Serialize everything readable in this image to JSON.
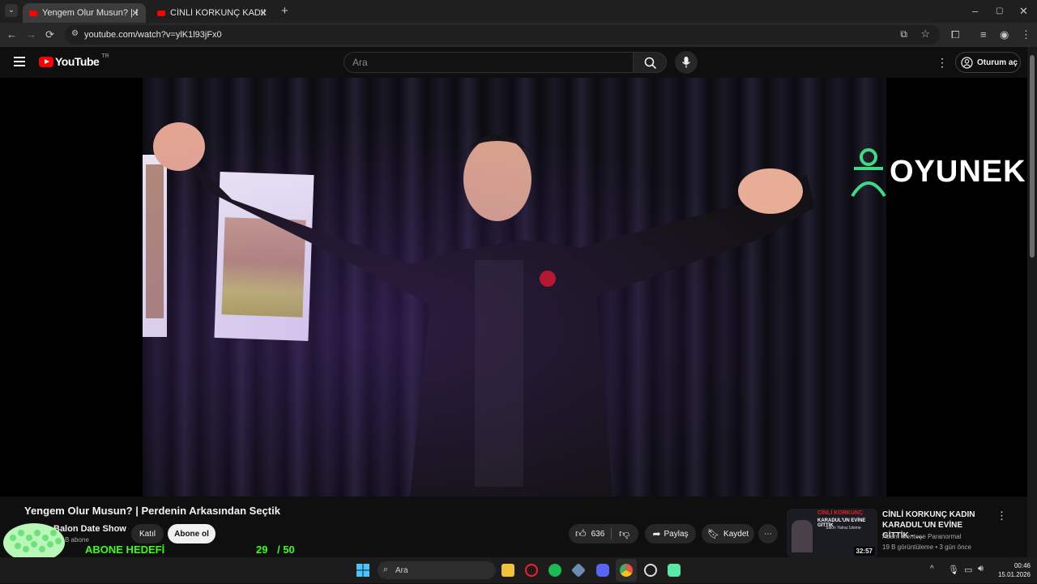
{
  "browser": {
    "tabs": [
      {
        "title": "Yengem Olur Musun? | Perdenin Arkasından Seçtik"
      },
      {
        "title": "CİNLİ KORKUNÇ KADIN KARADUL'UN EVİNE GİTTİK"
      }
    ],
    "url": "youtube.com/watch?v=ylK1l93jFx0"
  },
  "youtube": {
    "logo_text": "YouTube",
    "region": "TR",
    "search_placeholder": "Ara",
    "signin_label": "Oturum aç"
  },
  "video": {
    "watermark": "OYUNEKS",
    "title": "Yengem Olur Musun? | Perdenin Arkasından Seçtik",
    "channel_name": "Balon Date Show",
    "subscribers": "B abone",
    "join_label": "Katıl",
    "subscribe_label": "Abone ol",
    "likes": "636",
    "share_label": "Paylaş",
    "save_label": "Kaydet"
  },
  "recommended": {
    "title": "CİNLİ KORKUNÇ KADIN KARADUL'UN EVİNE GİTTİK - ...",
    "channel": "Adem Menteşe Paranormal",
    "meta": "19 B görüntüleme • 3 gün önce",
    "duration": "32:57",
    "thumb_line1": "CİNLİ KORKUNÇ",
    "thumb_line2": "KARADUL'UN EVİNE GİTTİK",
    "thumb_line3": "Sakın Yalnız İzleme"
  },
  "overlay": {
    "goal_label": "ABONE HEDEFİ",
    "goal_current": "29",
    "goal_target": "/ 50",
    "goal_progress": 0.58
  },
  "taskbar": {
    "search_placeholder": "Ara",
    "time": "00:46",
    "date": "15.01.2026"
  },
  "colors": {
    "accent_green": "#39ff14",
    "youtube_red": "#ff0000"
  }
}
